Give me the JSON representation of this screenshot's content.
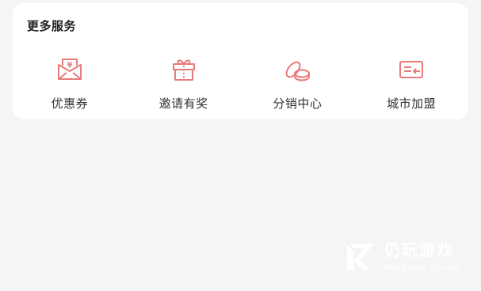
{
  "section": {
    "title": "更多服务",
    "items": [
      {
        "label": "优惠券",
        "icon": "coupon-icon"
      },
      {
        "label": "邀请有奖",
        "icon": "gift-icon"
      },
      {
        "label": "分销中心",
        "icon": "coins-icon"
      },
      {
        "label": "城市加盟",
        "icon": "card-icon"
      }
    ]
  },
  "watermark": {
    "name": "仍玩游戏",
    "subtitle": "Rengwan Games"
  },
  "colors": {
    "accent": "#e87b7b",
    "background": "#f5f5f5",
    "card": "#ffffff"
  }
}
